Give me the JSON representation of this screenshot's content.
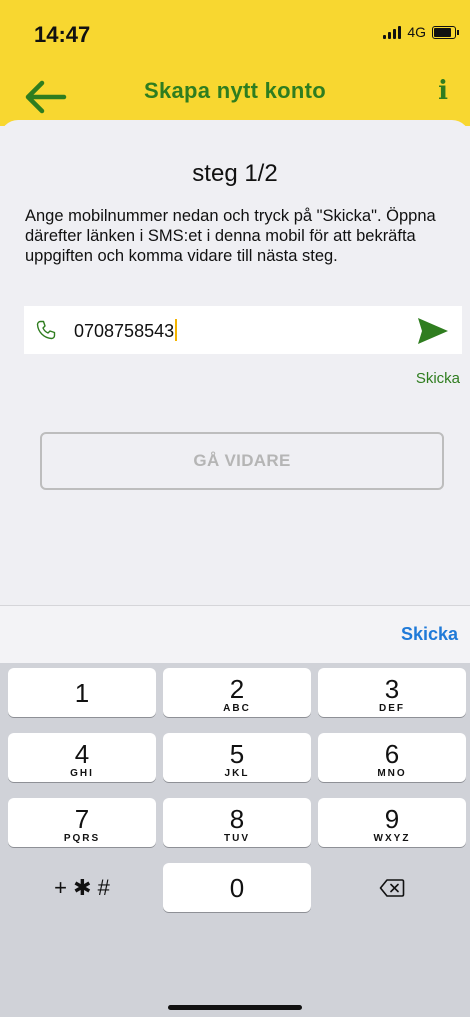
{
  "status_bar": {
    "time": "14:47",
    "network": "4G"
  },
  "nav": {
    "title": "Skapa nytt konto",
    "info_label": "i"
  },
  "step": {
    "title": "steg 1/2",
    "instructions": "Ange mobilnummer nedan och tryck på \"Skicka\". Öppna därefter länken i SMS:et i denna mobil för att bekräfta uppgiften och komma vidare till nästa steg."
  },
  "phone_field": {
    "value": "0708758543",
    "send_label": "Skicka"
  },
  "continue_button": {
    "label": "GÅ VIDARE"
  },
  "keyboard_bar": {
    "send_label": "Skicka"
  },
  "keypad": {
    "keys": [
      {
        "number": "1",
        "letters": ""
      },
      {
        "number": "2",
        "letters": "ABC"
      },
      {
        "number": "3",
        "letters": "DEF"
      },
      {
        "number": "4",
        "letters": "GHI"
      },
      {
        "number": "5",
        "letters": "JKL"
      },
      {
        "number": "6",
        "letters": "MNO"
      },
      {
        "number": "7",
        "letters": "PQRS"
      },
      {
        "number": "8",
        "letters": "TUV"
      },
      {
        "number": "9",
        "letters": "WXYZ"
      },
      {
        "number": "0",
        "letters": ""
      }
    ],
    "symbols_label": "+ ✱ #"
  },
  "colors": {
    "brand_yellow": "#f8d730",
    "brand_green": "#2f7d1f",
    "link_blue": "#1f7ad8"
  }
}
